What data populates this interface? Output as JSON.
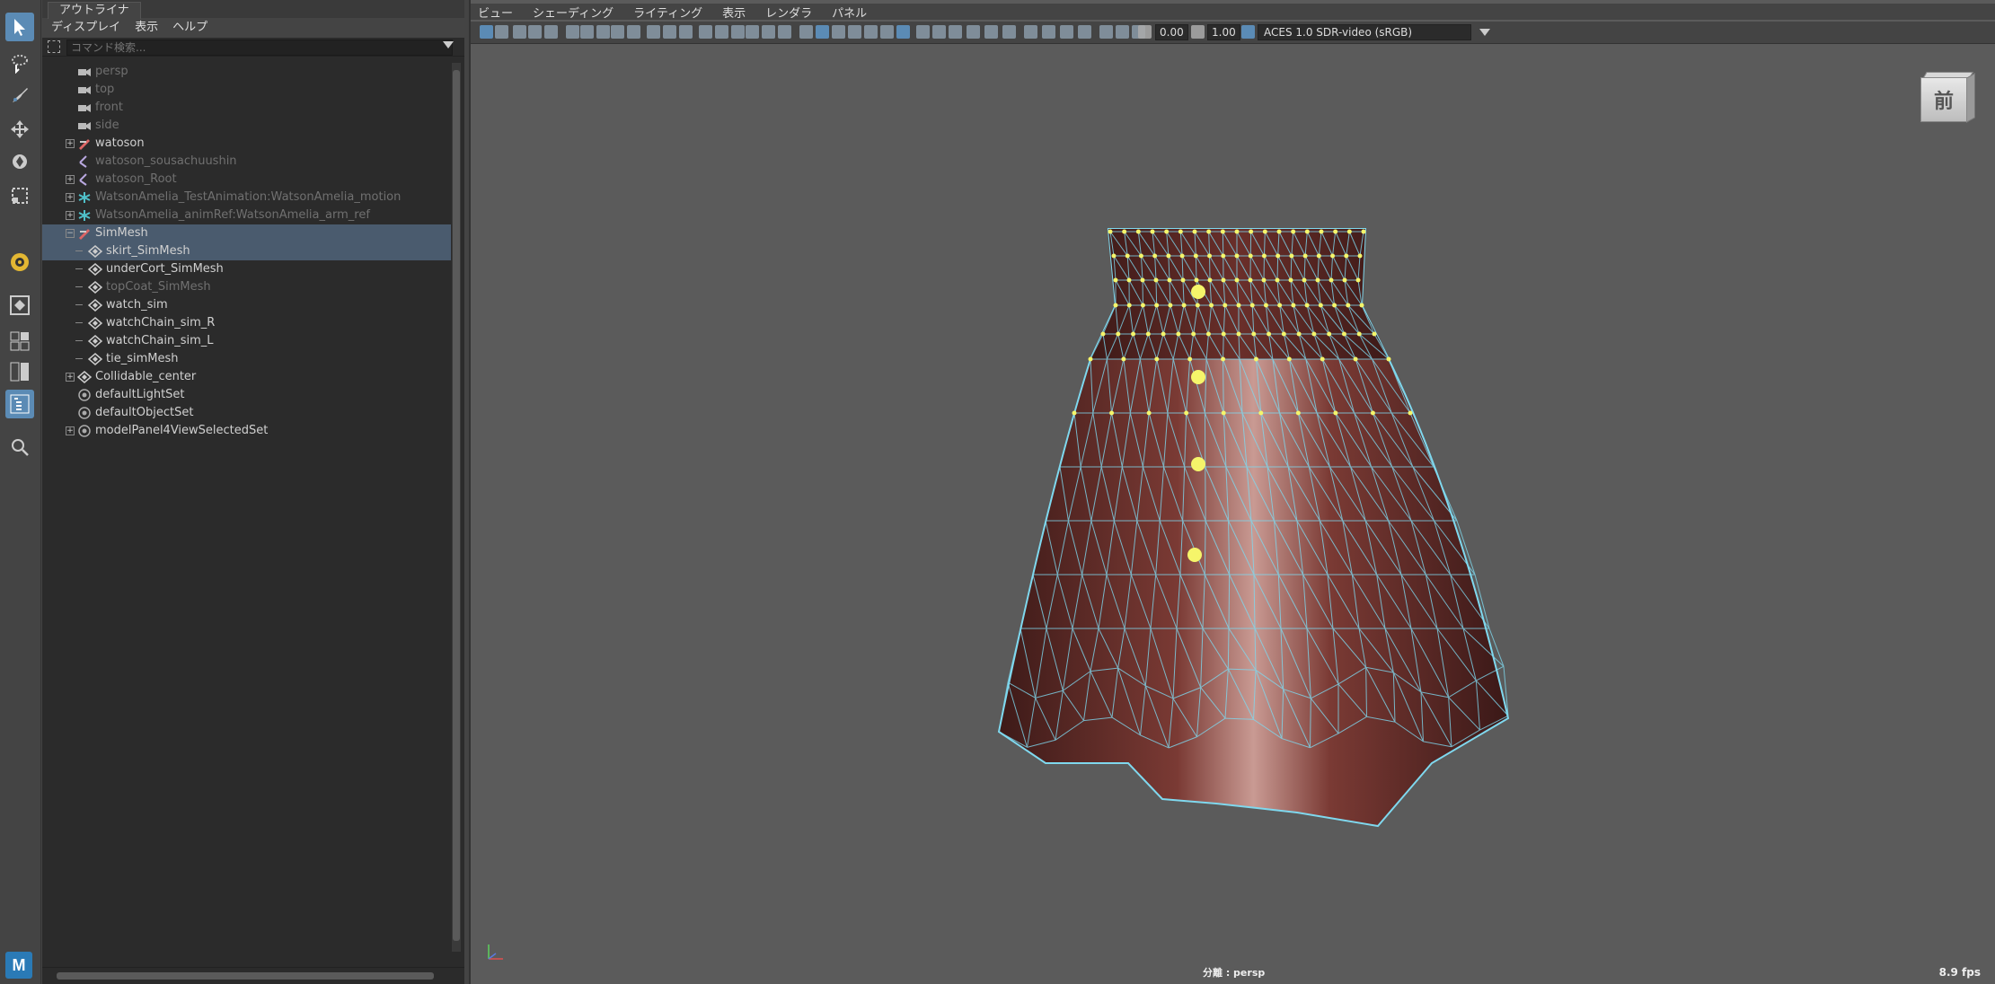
{
  "outliner": {
    "tab_title": "アウトライナ",
    "menu": [
      "ディスプレイ",
      "表示",
      "ヘルプ"
    ],
    "search_placeholder": "コマンド検索...",
    "items": [
      {
        "label": "persp",
        "icon": "camera-icon",
        "depth": 0,
        "expand": "",
        "dim": true,
        "selected": false
      },
      {
        "label": "top",
        "icon": "camera-icon",
        "depth": 0,
        "expand": "",
        "dim": true,
        "selected": false
      },
      {
        "label": "front",
        "icon": "camera-icon",
        "depth": 0,
        "expand": "",
        "dim": true,
        "selected": false
      },
      {
        "label": "side",
        "icon": "camera-icon",
        "depth": 0,
        "expand": "",
        "dim": true,
        "selected": false
      },
      {
        "label": "watoson",
        "icon": "group-icon",
        "depth": 0,
        "expand": "+",
        "dim": false,
        "selected": false
      },
      {
        "label": "watoson_sousachuushin",
        "icon": "joint-icon",
        "depth": 0,
        "expand": "",
        "dim": true,
        "selected": false
      },
      {
        "label": "watoson_Root",
        "icon": "joint-icon",
        "depth": 0,
        "expand": "+",
        "dim": true,
        "selected": false
      },
      {
        "label": "WatsonAmelia_TestAnimation:WatsonAmelia_motion",
        "icon": "asterisk-icon",
        "depth": 0,
        "expand": "+",
        "dim": true,
        "selected": false
      },
      {
        "label": "WatsonAmelia_animRef:WatsonAmelia_arm_ref",
        "icon": "asterisk-icon",
        "depth": 0,
        "expand": "+",
        "dim": true,
        "selected": false
      },
      {
        "label": "SimMesh",
        "icon": "group-icon",
        "depth": 0,
        "expand": "−",
        "dim": false,
        "selected": true
      },
      {
        "label": "skirt_SimMesh",
        "icon": "mesh-icon",
        "depth": 1,
        "expand": "",
        "dim": false,
        "selected": true
      },
      {
        "label": "underCort_SimMesh",
        "icon": "mesh-icon",
        "depth": 1,
        "expand": "",
        "dim": false,
        "selected": false
      },
      {
        "label": "topCoat_SimMesh",
        "icon": "mesh-icon",
        "depth": 1,
        "expand": "",
        "dim": true,
        "selected": false
      },
      {
        "label": "watch_sim",
        "icon": "mesh-icon",
        "depth": 1,
        "expand": "",
        "dim": false,
        "selected": false
      },
      {
        "label": "watchChain_sim_R",
        "icon": "mesh-icon",
        "depth": 1,
        "expand": "",
        "dim": false,
        "selected": false
      },
      {
        "label": "watchChain_sim_L",
        "icon": "mesh-icon",
        "depth": 1,
        "expand": "",
        "dim": false,
        "selected": false
      },
      {
        "label": "tie_simMesh",
        "icon": "mesh-icon",
        "depth": 1,
        "expand": "",
        "dim": false,
        "selected": false
      },
      {
        "label": "Collidable_center",
        "icon": "mesh-icon",
        "depth": 0,
        "expand": "+",
        "dim": false,
        "selected": false
      },
      {
        "label": "defaultLightSet",
        "icon": "set-icon",
        "depth": 0,
        "expand": "",
        "dim": false,
        "selected": false
      },
      {
        "label": "defaultObjectSet",
        "icon": "set-icon",
        "depth": 0,
        "expand": "",
        "dim": false,
        "selected": false
      },
      {
        "label": "modelPanel4ViewSelectedSet",
        "icon": "set-icon",
        "depth": 0,
        "expand": "+",
        "dim": false,
        "selected": false
      }
    ]
  },
  "viewport": {
    "menu": [
      "ビュー",
      "シェーディング",
      "ライティング",
      "表示",
      "レンダラ",
      "パネル"
    ],
    "exposure": "0.00",
    "gamma": "1.00",
    "color_space": "ACES 1.0 SDR-video (sRGB)",
    "viewcube_label": "前",
    "camera_label": "分離 : persp",
    "fps": "8.9 fps"
  },
  "maya_logo": "M",
  "colors": {
    "selection": "#4a5b6e",
    "accent": "#5b8bb5",
    "wire": "#7fd8ee",
    "vertex": "#f5f56a"
  }
}
